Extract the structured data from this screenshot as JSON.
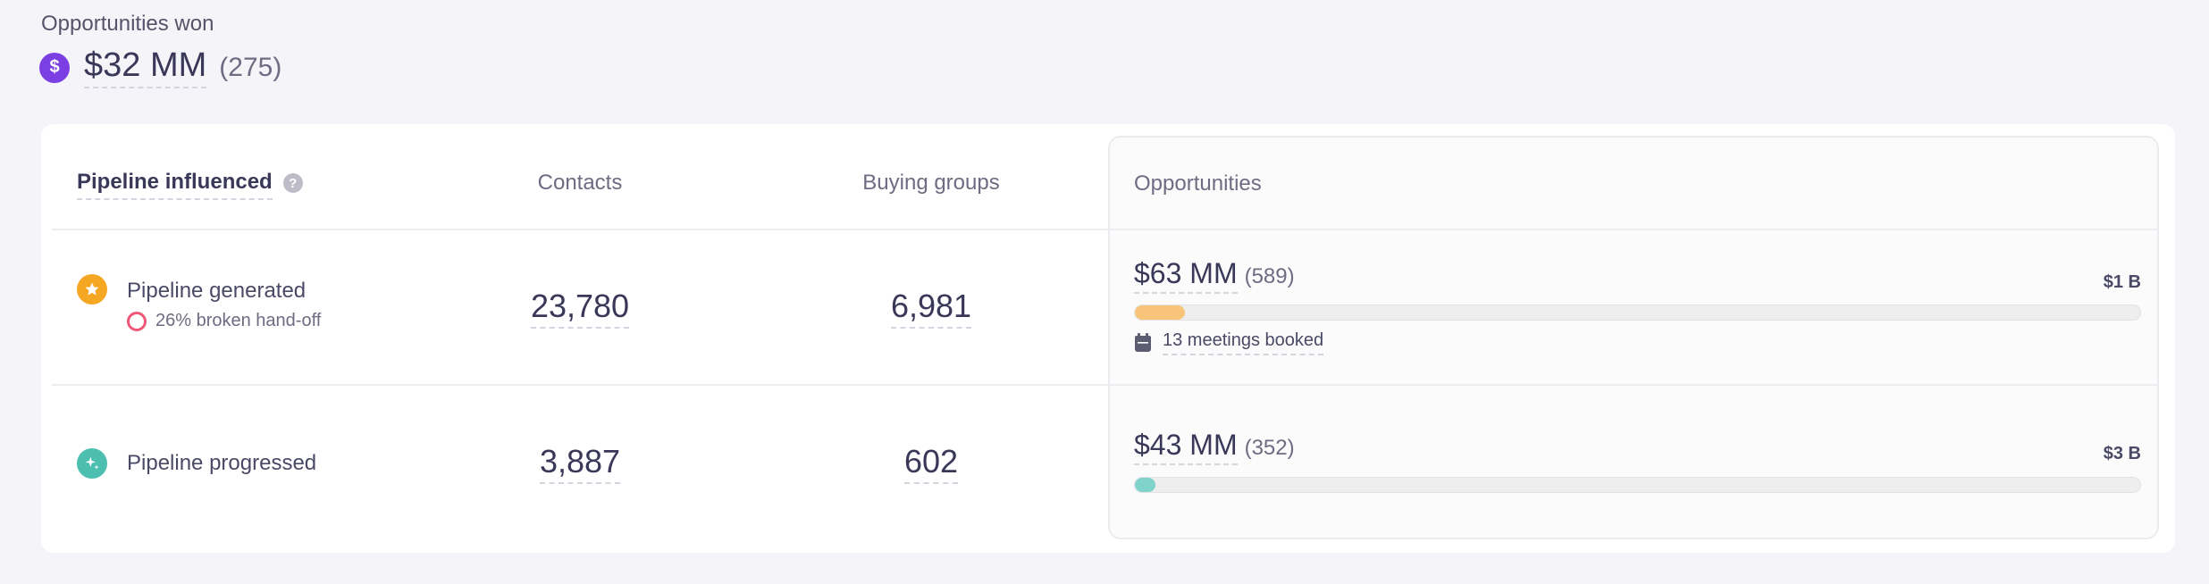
{
  "summary": {
    "label": "Opportunities won",
    "icon": "dollar-icon",
    "icon_glyph": "$",
    "amount": "$32 MM",
    "count": "(275)",
    "accent": "#7b3fe4"
  },
  "table": {
    "headers": {
      "pipeline": "Pipeline influenced",
      "contacts": "Contacts",
      "buying_groups": "Buying groups",
      "opportunities": "Opportunities"
    },
    "rows": [
      {
        "title": "Pipeline generated",
        "icon": "star-icon",
        "icon_color": "#f5a623",
        "sub": "26% broken hand-off",
        "sub_icon": "ring-icon",
        "contacts": "23,780",
        "buying_groups": "6,981",
        "opp_amount": "$63 MM",
        "opp_count": "(589)",
        "opp_max": "$1 B",
        "progress_fraction": 0.05,
        "bar_color": "#f7c47a",
        "meetings": "13 meetings booked",
        "meetings_icon": "calendar-icon"
      },
      {
        "title": "Pipeline progressed",
        "icon": "sparkle-icon",
        "icon_color": "#4cbfb1",
        "contacts": "3,887",
        "buying_groups": "602",
        "opp_amount": "$43 MM",
        "opp_count": "(352)",
        "opp_max": "$3 B",
        "progress_fraction": 0.02,
        "bar_color": "#7fd3cb"
      }
    ]
  }
}
